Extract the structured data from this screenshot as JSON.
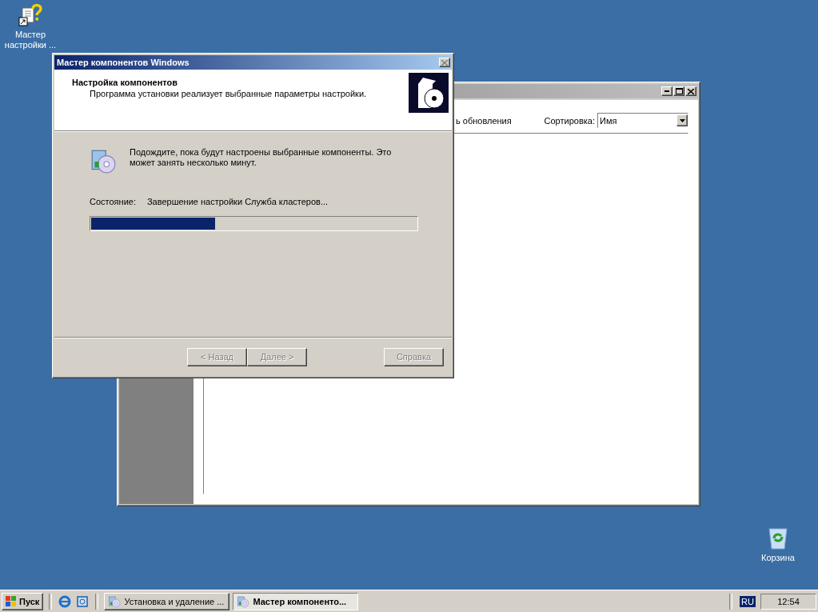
{
  "desktop_icons": [
    {
      "kind": "wizard",
      "label": "Мастер настройки ..."
    },
    {
      "kind": "recycle",
      "label": "Корзина"
    }
  ],
  "background_window": {
    "partial_text": "ь обновления",
    "sort_label": "Сортировка:",
    "sort_value": "Имя"
  },
  "dialog": {
    "title": "Мастер компонентов Windows",
    "header_title": "Настройка компонентов",
    "header_subtitle": "Программа установки реализует выбранные параметры настройки.",
    "message": "Подождите, пока будут настроены выбранные компоненты. Это может занять несколько минут.",
    "status_label": "Состояние:",
    "status_text": "Завершение настройки Служба кластеров...",
    "progress": {
      "level": 0.38
    },
    "buttons": [
      {
        "label": "< Назад",
        "disabled": true
      },
      {
        "label": "Далее >",
        "disabled": true
      },
      {
        "label": "Справка",
        "disabled": true
      }
    ]
  },
  "taskbar": {
    "start": "Пуск",
    "quick_launch": [
      {
        "kind": "browser"
      },
      {
        "kind": "outlook"
      }
    ],
    "tasks": [
      {
        "label": "Установка и удаление ...",
        "selected": false
      },
      {
        "label": "Мастер компоненто...",
        "selected": true
      }
    ],
    "language": "RU",
    "clock": "12:54"
  }
}
